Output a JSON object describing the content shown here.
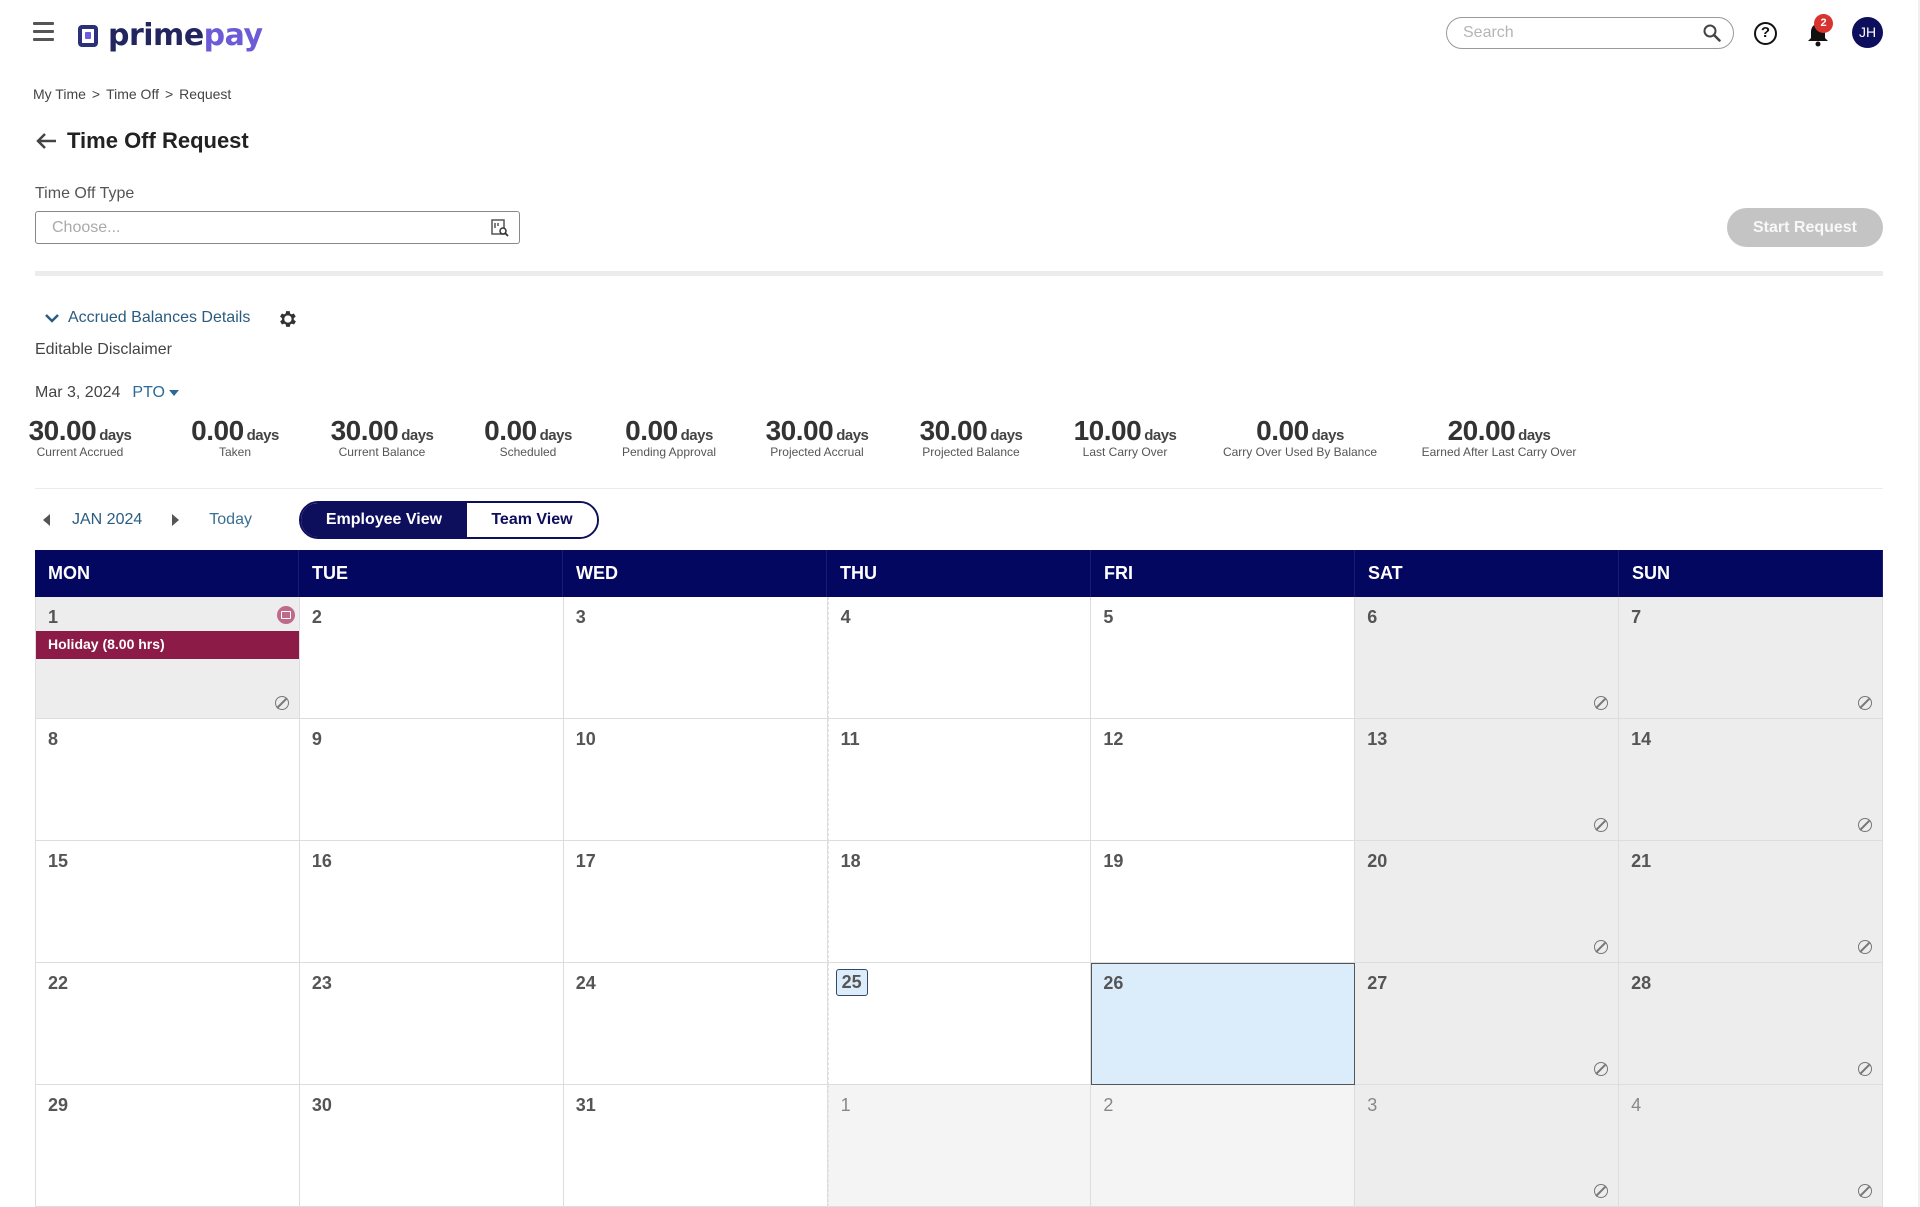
{
  "app": {
    "brand_prime": "prime",
    "brand_pay": "pay",
    "search_placeholder": "Search",
    "notification_count": "2",
    "user_initials": "JH",
    "help_glyph": "?"
  },
  "breadcrumb": [
    {
      "label": "My Time"
    },
    {
      "label": ">"
    },
    {
      "label": "Time Off"
    },
    {
      "label": ">"
    },
    {
      "label": "Request"
    }
  ],
  "page": {
    "title": "Time Off Request",
    "time_off_type_label": "Time Off Type",
    "time_off_type_placeholder": "Choose...",
    "start_request_label": "Start Request"
  },
  "accrued": {
    "toggle_label": "Accrued Balances Details",
    "disclaimer": "Editable Disclaimer",
    "as_of_date": "Mar 3, 2024",
    "policy": "PTO",
    "unit": "days",
    "balances": [
      {
        "value": "30.00",
        "label": "Current Accrued"
      },
      {
        "value": "0.00",
        "label": "Taken"
      },
      {
        "value": "30.00",
        "label": "Current Balance"
      },
      {
        "value": "0.00",
        "label": "Scheduled"
      },
      {
        "value": "0.00",
        "label": "Pending Approval"
      },
      {
        "value": "30.00",
        "label": "Projected Accrual"
      },
      {
        "value": "30.00",
        "label": "Projected Balance"
      },
      {
        "value": "10.00",
        "label": "Last Carry Over"
      },
      {
        "value": "0.00",
        "label": "Carry Over Used By Balance"
      },
      {
        "value": "20.00",
        "label": "Earned After Last Carry Over"
      }
    ]
  },
  "calendar_controls": {
    "month": "JAN 2024",
    "today_label": "Today",
    "employee_view_label": "Employee View",
    "team_view_label": "Team View",
    "active_view": "Employee View"
  },
  "calendar": {
    "weekdays": [
      "MON",
      "TUE",
      "WED",
      "THU",
      "FRI",
      "SAT",
      "SUN"
    ],
    "today": "25",
    "selected": "26",
    "weeks": [
      [
        "1",
        "2",
        "3",
        "4",
        "5",
        "6",
        "7"
      ],
      [
        "8",
        "9",
        "10",
        "11",
        "12",
        "13",
        "14"
      ],
      [
        "15",
        "16",
        "17",
        "18",
        "19",
        "20",
        "21"
      ],
      [
        "22",
        "23",
        "24",
        "25",
        "26",
        "27",
        "28"
      ],
      [
        "29",
        "30",
        "31",
        "1",
        "2",
        "3",
        "4"
      ]
    ],
    "events": [
      {
        "day": "1",
        "label": "Holiday (8.00 hrs)",
        "color": "#8c1c47"
      }
    ],
    "colors": {
      "header": "#04075f",
      "selected": "#dbecfb",
      "weekend": "#ededed"
    }
  }
}
